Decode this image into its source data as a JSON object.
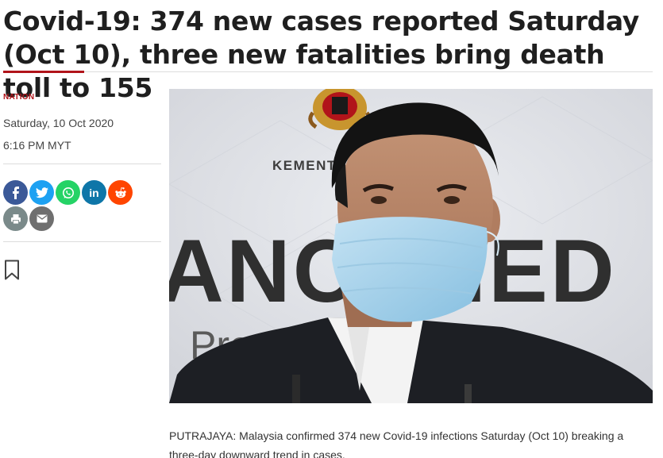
{
  "article": {
    "headline": "Covid-19: 374 new cases reported Saturday (Oct 10), three new fatalities bring death toll to 155",
    "category": "NATION",
    "date": "Saturday, 10 Oct 2020",
    "time": "6:16 PM MYT",
    "lead": "PUTRAJAYA: Malaysia confirmed 374 new Covid-19 infections Saturday (Oct 10) breaking a three-day downward trend in cases."
  },
  "share": {
    "buttons": [
      {
        "name": "facebook",
        "glyph": "f",
        "color": "#3b5998"
      },
      {
        "name": "twitter",
        "glyph": "t",
        "color": "#1da1f2"
      },
      {
        "name": "whatsapp",
        "glyph": "w",
        "color": "#25d366"
      },
      {
        "name": "linkedin",
        "glyph": "in",
        "color": "#0e76a8"
      },
      {
        "name": "reddit",
        "glyph": "r",
        "color": "#ff4500"
      },
      {
        "name": "print",
        "glyph": "p",
        "color": "#7a8a8a"
      },
      {
        "name": "email",
        "glyph": "e",
        "color": "#6f6f6f"
      }
    ]
  },
  "photo": {
    "backdrop_text_top": "KEMENT",
    "backdrop_text_big": "ANC  IED",
    "backdrop_text_bottom": "Pre    nce",
    "subject": "man in suit wearing blue surgical mask at press conference"
  },
  "colors": {
    "accent": "#b1141a",
    "headline": "#1f1f1f",
    "rule": "#dcdcdc"
  }
}
